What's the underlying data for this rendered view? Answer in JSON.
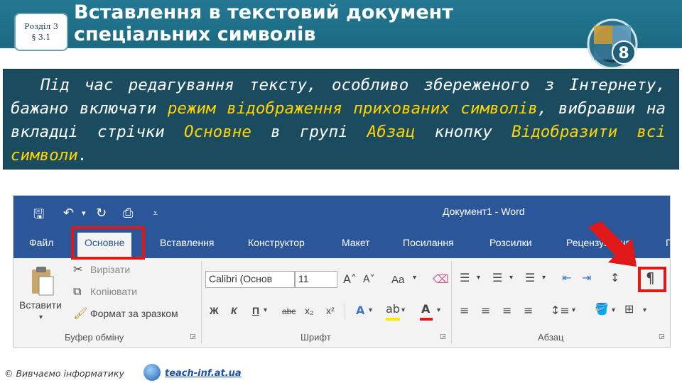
{
  "header": {
    "badge_line1": "Розділ 3",
    "badge_line2": "§ 3.1",
    "title_line1": "Вставлення в текстовий документ",
    "title_line2": "спеціальних символів",
    "grade": "8"
  },
  "intro": {
    "t1": "Під час редагування тексту, особливо збереженого з Інтернету, бажано включати ",
    "h1": "режим відображення прихованих символів",
    "t2": ", вибравши на вкладці стрічки ",
    "h2": "Основне",
    "t3": " в групі ",
    "h3": "Абзац",
    "t4": " кнопку ",
    "h4": "Відобразити всі символи",
    "t5": "."
  },
  "word": {
    "window_title": "Документ1 - Word",
    "tabs": [
      "Файл",
      "Основне",
      "Вставлення",
      "Конструктор",
      "Макет",
      "Посилання",
      "Розсилки",
      "Рецензування",
      "П"
    ],
    "active_tab": "Основне",
    "clipboard": {
      "paste": "Вставити",
      "cut": "Вирізати",
      "copy": "Копіювати",
      "format_painter": "Формат за зразком",
      "group": "Буфер обміну"
    },
    "font": {
      "name": "Calibri (Основ",
      "size": "11",
      "group": "Шрифт",
      "case_btn": "Aa",
      "bold": "Ж",
      "italic": "К",
      "underline": "П",
      "strike": "abc",
      "sub": "x₂",
      "sup": "x²"
    },
    "paragraph": {
      "group": "Абзац",
      "show_marks": "¶"
    }
  },
  "footer": {
    "copyright": "© Вивчаємо інформатику",
    "site": "teach-inf.at.ua"
  },
  "colors": {
    "header_bg": "#1f6e86",
    "text_block_bg": "#1a4b5e",
    "highlight": "#ffd400",
    "word_blue": "#2b579a",
    "marker_red": "#e01818"
  }
}
